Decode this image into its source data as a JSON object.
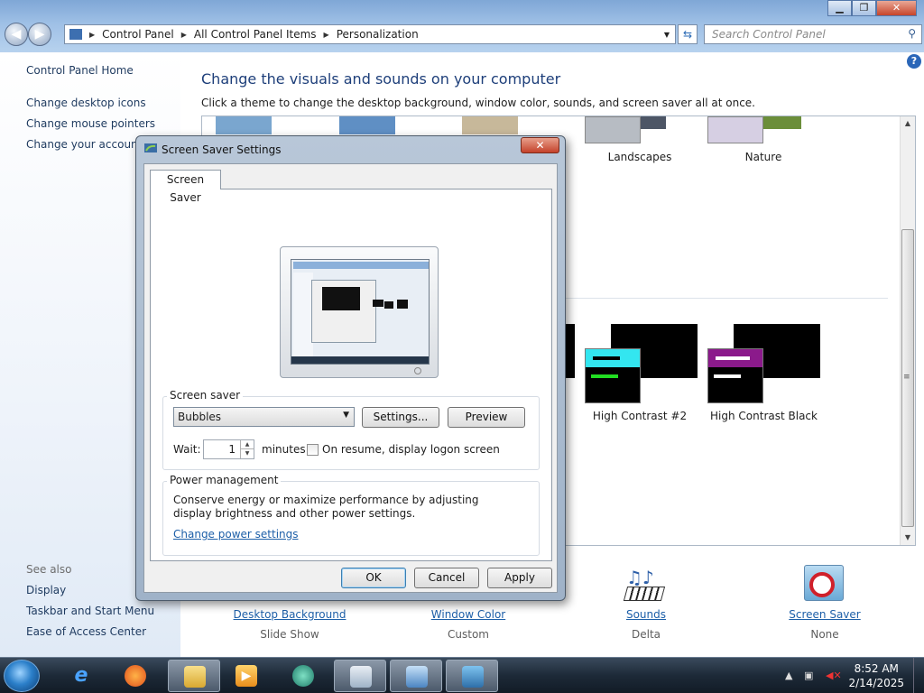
{
  "window": {
    "breadcrumb": [
      "Control Panel",
      "All Control Panel Items",
      "Personalization"
    ],
    "search_placeholder": "Search Control Panel",
    "controls": {
      "minimize": "▁",
      "maximize": "❐",
      "close": "✕"
    }
  },
  "sidebar": {
    "items": [
      "Control Panel Home",
      "Change desktop icons",
      "Change mouse pointers",
      "Change your account p"
    ],
    "see_also_label": "See also",
    "see_also": [
      "Display",
      "Taskbar and Start Menu",
      "Ease of Access Center"
    ]
  },
  "main": {
    "heading": "Change the visuals and sounds on your computer",
    "subheading": "Click a theme to change the desktop background, window color, sounds, and screen saver all at once.",
    "themes": [
      "Landscapes",
      "Nature",
      "High Contrast #2",
      "High Contrast Black"
    ],
    "bottom": [
      {
        "label": "Desktop Background",
        "value": "Slide Show"
      },
      {
        "label": "Window Color",
        "value": "Custom"
      },
      {
        "label": "Sounds",
        "value": "Delta"
      },
      {
        "label": "Screen Saver",
        "value": "None"
      }
    ]
  },
  "dialog": {
    "title": "Screen Saver Settings",
    "tab": "Screen Saver",
    "screen_saver_group": "Screen saver",
    "selected_saver": "Bubbles",
    "settings_button": "Settings...",
    "preview_button": "Preview",
    "wait_label": "Wait:",
    "wait_value": "1",
    "minutes_label": "minutes",
    "resume_label": "On resume, display logon screen",
    "resume_checked": false,
    "power_group": "Power management",
    "power_text": "Conserve energy or maximize performance by adjusting display brightness and other power settings.",
    "power_link": "Change power settings",
    "ok": "OK",
    "cancel": "Cancel",
    "apply": "Apply"
  },
  "taskbar": {
    "time": "8:52 AM",
    "date": "2/14/2025"
  },
  "colors": {
    "link": "#1d5fa8",
    "heading": "#1e3f7a",
    "hc2_accent": "#33e6f0",
    "hc2_green": "#22dd22",
    "hcblack_accent": "#8b1a8b"
  }
}
